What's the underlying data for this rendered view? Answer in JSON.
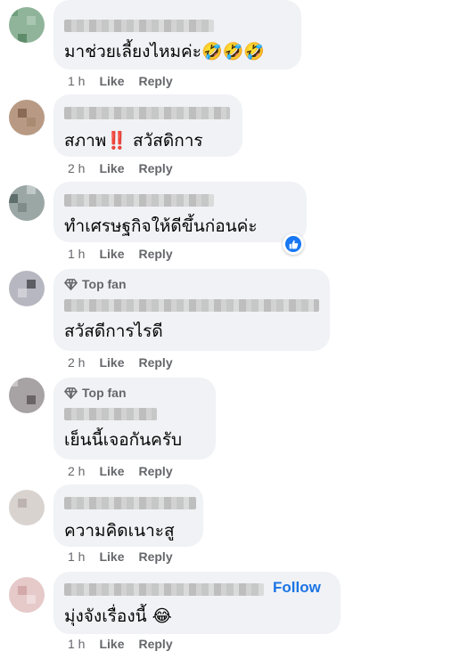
{
  "comments": [
    {
      "text": "มาช่วยเลี้ยงไหมค่ะ🤣🤣🤣",
      "time": "1 h",
      "like": "Like",
      "reply": "Reply"
    },
    {
      "text": "สภาพ‼️ สวัสดิการ",
      "time": "2 h",
      "like": "Like",
      "reply": "Reply"
    },
    {
      "text": "ทำเศรษฐกิจให้ดีขึ้นก่อนค่ะ",
      "time": "1 h",
      "like": "Like",
      "reply": "Reply"
    },
    {
      "badge": "Top fan",
      "text": "สวัสดีการไรดี",
      "time": "2 h",
      "like": "Like",
      "reply": "Reply"
    },
    {
      "badge": "Top fan",
      "text": "เย็นนี้เจอกันครับ",
      "time": "2 h",
      "like": "Like",
      "reply": "Reply"
    },
    {
      "text": "ความคิดเนาะสู",
      "time": "1 h",
      "like": "Like",
      "reply": "Reply"
    },
    {
      "follow": "Follow",
      "text": "มุ่งจังเรื่องนี้ 😂",
      "time": "1 h",
      "like": "Like",
      "reply": "Reply"
    }
  ]
}
